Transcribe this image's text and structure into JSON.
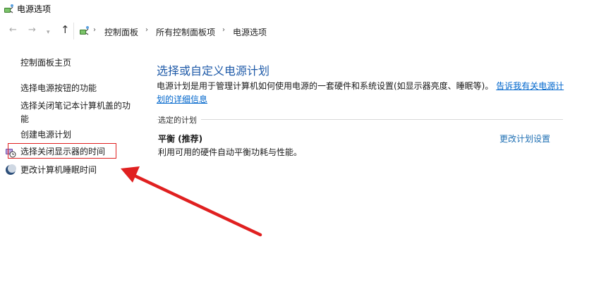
{
  "window": {
    "title": "电源选项"
  },
  "nav": {
    "back_icon": "arrow-left-icon",
    "forward_icon": "arrow-right-icon",
    "recent_icon": "chevron-down-icon",
    "up_icon": "arrow-up-icon",
    "breadcrumb": [
      "控制面板",
      "所有控制面板项",
      "电源选项"
    ],
    "separator": "›"
  },
  "sidebar": {
    "home_link": "控制面板主页",
    "links": [
      "选择电源按钮的功能",
      "选择关闭笔记本计算机盖的功能",
      "创建电源计划",
      "选择关闭显示器的时间",
      "更改计算机睡眠时间"
    ],
    "icons": [
      "monitor-clock-icon",
      "moon-sleep-icon"
    ]
  },
  "main": {
    "heading": "选择或自定义电源计划",
    "description": "电源计划是用于管理计算机如何使用电源的一套硬件和系统设置(如显示器亮度、睡眠等)。",
    "description_link": "告诉我有关电源计划的详细信息",
    "group_label": "选定的计划",
    "plan_name": "平衡 (推荐)",
    "plan_description": "利用可用的硬件自动平衡功耗与性能。",
    "plan_change_link": "更改计划设置"
  },
  "colors": {
    "link": "#1e6fb3",
    "heading": "#1e5aa8",
    "annotation": "#e02020"
  }
}
